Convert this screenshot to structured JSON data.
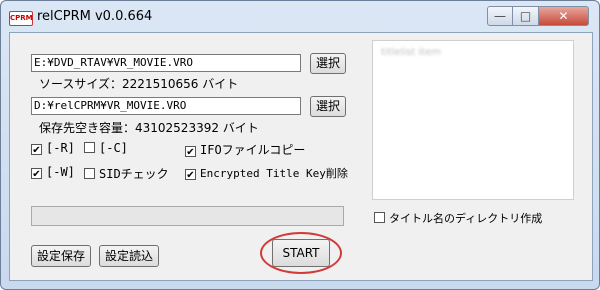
{
  "window": {
    "title": "relCPRM v0.0.664",
    "icon_text": "CPRM",
    "controls": {
      "minimize": "—",
      "maximize": "□",
      "close": "✕"
    }
  },
  "source": {
    "path": "E:¥DVD_RTAV¥VR_MOVIE.VRO",
    "browse_label": "選択",
    "size_text": "ソースサイズ：2221510656 バイト"
  },
  "destination": {
    "path": "D:¥relCPRM¥VR_MOVIE.VRO",
    "browse_label": "選択",
    "free_space_text": "保存先空き容量：43102523392 バイト"
  },
  "options": {
    "r": {
      "label": "[-R]",
      "checked": true
    },
    "c": {
      "label": "[-C]",
      "checked": false
    },
    "ifo": {
      "label": "IFOファイルコピー",
      "checked": true
    },
    "w": {
      "label": "[-W]",
      "checked": true
    },
    "sid": {
      "label": "SIDチェック",
      "checked": false
    },
    "encrypted": {
      "label": "Encrypted Title Key削除",
      "checked": true
    },
    "title_dir": {
      "label": "タイトル名のディレクトリ作成",
      "checked": false
    }
  },
  "title_list": {
    "placeholder_blurred": "titlelist item"
  },
  "progress": {
    "value": 0
  },
  "buttons": {
    "save_settings": "設定保存",
    "load_settings": "設定読込",
    "start": "START"
  },
  "colors": {
    "highlight": "#d23a3a",
    "progress_fill": "#3cb043"
  }
}
